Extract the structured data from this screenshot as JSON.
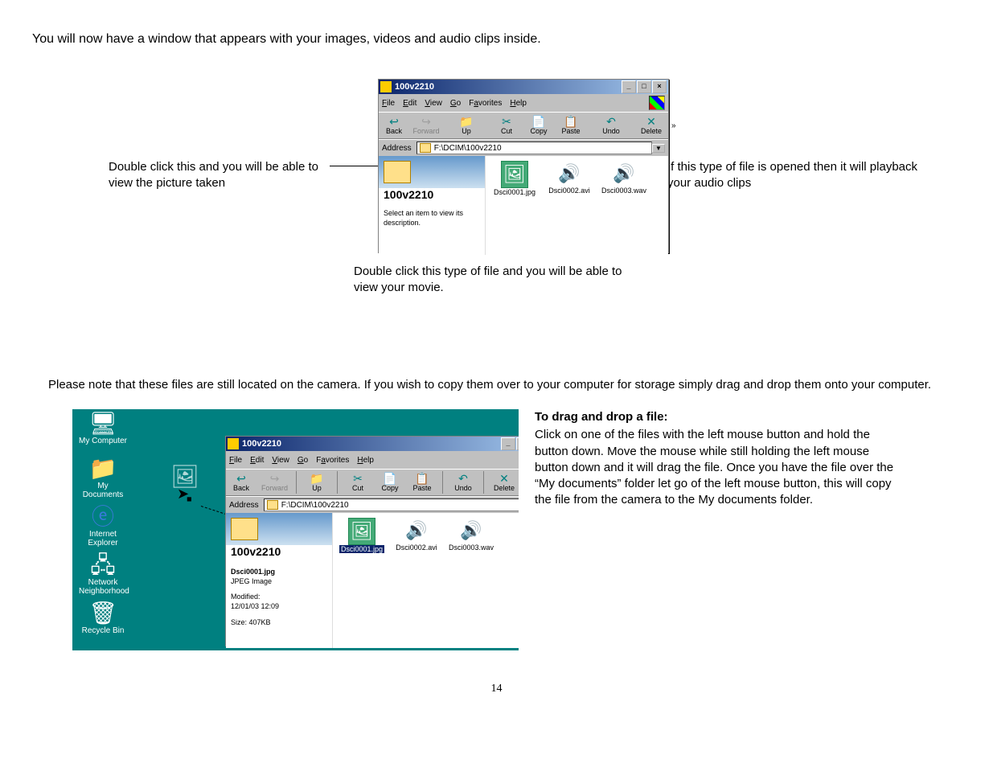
{
  "intro": "You will now have a window that appears with your images, videos and audio clips inside.",
  "callout_left": "Double click this and you will be able to view the picture taken",
  "callout_right": "If this type of file is opened then it will playback your audio clips",
  "callout_bottom": "Double click this type of file and you will be able to view your movie.",
  "explorer1": {
    "title": "100v2210",
    "menu": {
      "file": "File",
      "edit": "Edit",
      "view": "View",
      "go": "Go",
      "fav": "Favorites",
      "help": "Help"
    },
    "toolbar": {
      "back": "Back",
      "forward": "Forward",
      "up": "Up",
      "cut": "Cut",
      "copy": "Copy",
      "paste": "Paste",
      "undo": "Undo",
      "delete": "Delete"
    },
    "address_label": "Address",
    "address_value": "F:\\DCIM\\100v2210",
    "folder_title": "100v2210",
    "select_hint": "Select an item to view its description.",
    "files": [
      {
        "name": "Dsci0001.jpg",
        "kind": "pic"
      },
      {
        "name": "Dsci0002.avi",
        "kind": "aud"
      },
      {
        "name": "Dsci0003.wav",
        "kind": "aud"
      }
    ]
  },
  "note": "Please note that these files are still located on the camera. If you wish to copy them over to your computer for storage simply drag and drop them onto your computer.",
  "desktop_icons": {
    "my_computer": "My Computer",
    "my_documents": "My Documents",
    "ie": "Internet Explorer",
    "network": "Network Neighborhood",
    "recycle": "Recycle Bin"
  },
  "explorer2": {
    "title": "100v2210",
    "menu": {
      "file": "File",
      "edit": "Edit",
      "view": "View",
      "go": "Go",
      "fav": "Favorites",
      "help": "Help"
    },
    "toolbar": {
      "back": "Back",
      "forward": "Forward",
      "up": "Up",
      "cut": "Cut",
      "copy": "Copy",
      "paste": "Paste",
      "undo": "Undo",
      "delete": "Delete"
    },
    "address_label": "Address",
    "address_value": "F:\\DCIM\\100v2210",
    "folder_title": "100v2210",
    "files": [
      {
        "name": "Dsci0001.jpg",
        "kind": "pic-sel"
      },
      {
        "name": "Dsci0002.avi",
        "kind": "aud"
      },
      {
        "name": "Dsci0003.wav",
        "kind": "aud"
      }
    ],
    "details": {
      "name": "Dsci0001.jpg",
      "type": "JPEG Image",
      "modified_label": "Modified:",
      "modified_value": "12/01/03 12:09",
      "size_label": "Size: 407KB"
    }
  },
  "instructions": {
    "heading": "To drag and drop a file:",
    "body": "Click on one of the files with the left mouse button and hold the button down. Move the mouse while still holding the left mouse button down and it will drag the file. Once you have the file over the “My documents” folder let go of the left mouse button, this will copy the file from the camera to the My documents folder."
  },
  "page_number": "14"
}
